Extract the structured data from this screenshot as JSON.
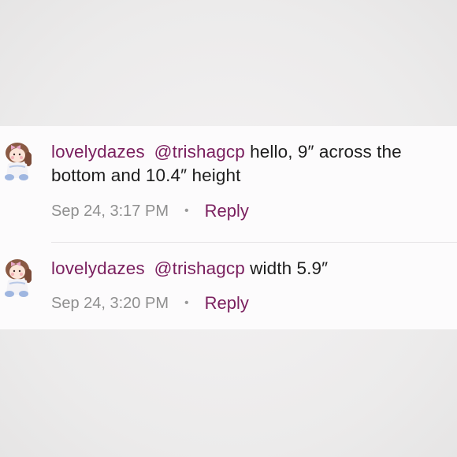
{
  "comments": [
    {
      "username": "lovelydazes",
      "mention": "@trishagcp",
      "text": " hello, 9″ across the bottom and 10.4″ height",
      "timestamp": "Sep 24, 3:17 PM",
      "separator": "•",
      "reply_label": "Reply"
    },
    {
      "username": "lovelydazes",
      "mention": "@trishagcp",
      "text": " width 5.9″",
      "timestamp": "Sep 24, 3:20 PM",
      "separator": "•",
      "reply_label": "Reply"
    }
  ],
  "colors": {
    "accent": "#7a1f5e",
    "text": "#1e1e1e",
    "muted": "#8f8f8f"
  },
  "icons": {
    "avatar": "user-avatar-illustration"
  }
}
